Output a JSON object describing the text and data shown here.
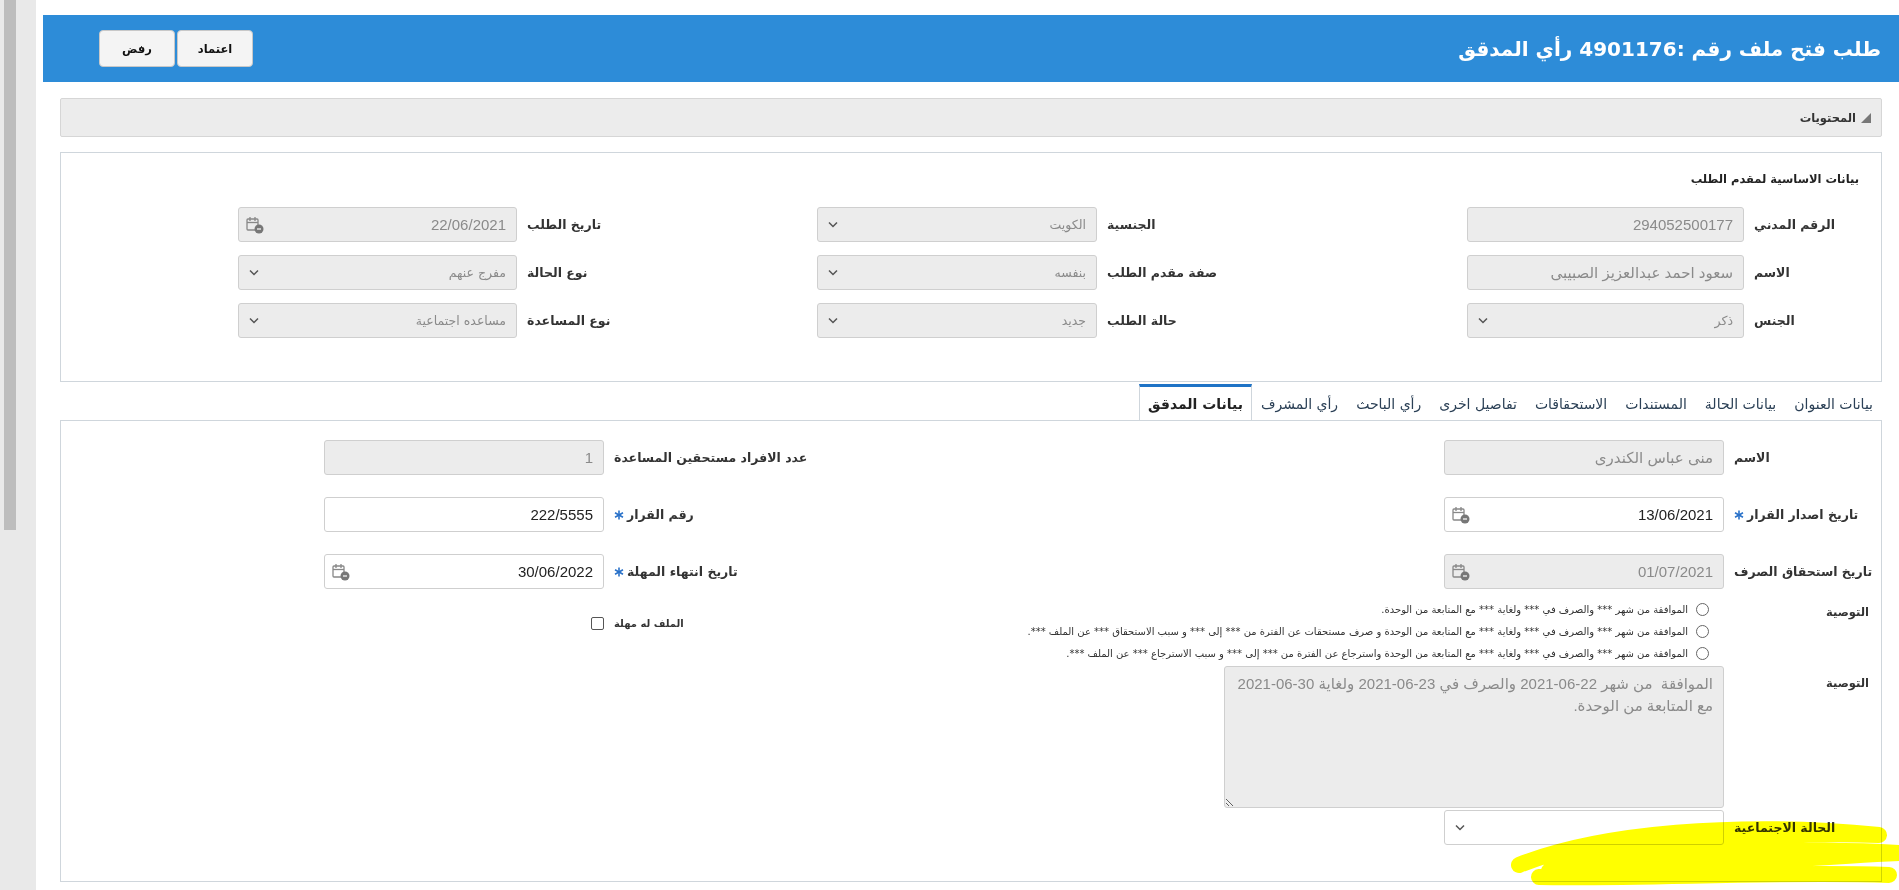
{
  "header": {
    "title": "طلب فتح ملف رقم :4901176 رأي المدقق",
    "buttons": [
      "اعتماد",
      "رفض"
    ]
  },
  "contents_bar": {
    "label": "المحتويات"
  },
  "basic_data": {
    "title": "بيانات الاساسية لمقدم الطلب",
    "columns": [
      [
        {
          "label": "الرقم المدني",
          "value": "294052500177",
          "kind": "text",
          "disabled": true
        },
        {
          "label": "الاسم",
          "value": "سعود احمد عبدالعزيز الصبيبى",
          "kind": "text",
          "disabled": true
        },
        {
          "label": "الجنس",
          "value": "ذكر",
          "kind": "select",
          "disabled": true
        }
      ],
      [
        {
          "label": "الجنسية",
          "value": "الكويت",
          "kind": "select",
          "disabled": true
        },
        {
          "label": "صفة مقدم الطلب",
          "value": "بنفسه",
          "kind": "select",
          "disabled": true
        },
        {
          "label": "حالة الطلب",
          "value": "جديد",
          "kind": "select",
          "disabled": true
        }
      ],
      [
        {
          "label": "تاريخ الطلب",
          "value": "22/06/2021",
          "kind": "date",
          "disabled": true
        },
        {
          "label": "نوع الحالة",
          "value": "مفرج عنهم",
          "kind": "select",
          "disabled": true
        },
        {
          "label": "نوع المساعدة",
          "value": "مساعده اجتماعية",
          "kind": "select",
          "disabled": true
        }
      ]
    ]
  },
  "tabs": [
    {
      "label": "بيانات العنوان",
      "selected": false
    },
    {
      "label": "بيانات الحالة",
      "selected": false
    },
    {
      "label": "المستندات",
      "selected": false
    },
    {
      "label": "الاستحقاقات",
      "selected": false
    },
    {
      "label": "تفاصيل اخرى",
      "selected": false
    },
    {
      "label": "رأي الباحث",
      "selected": false
    },
    {
      "label": "رأي المشرف",
      "selected": false
    },
    {
      "label": "بيانات المدقق",
      "selected": true
    }
  ],
  "auditor": {
    "right_fields": [
      {
        "label": "الاسم",
        "value": "منى عباس الكندرى",
        "kind": "text",
        "disabled": true,
        "required": false
      },
      {
        "label": "تاريخ اصدار القرار",
        "value": "13/06/2021",
        "kind": "date",
        "disabled": false,
        "required": true
      },
      {
        "label": "تاريخ استحقاق الصرف",
        "value": "01/07/2021",
        "kind": "date",
        "disabled": true,
        "required": false
      }
    ],
    "left_fields": [
      {
        "label": "عدد الافراد مستحقين المساعدة",
        "value": "1",
        "kind": "text",
        "disabled": true,
        "required": false
      },
      {
        "label": "رقم القرار",
        "value": "222/5555",
        "kind": "text",
        "disabled": false,
        "required": true
      },
      {
        "label": "تاريخ انتهاء المهلة",
        "value": "30/06/2022",
        "kind": "date",
        "disabled": false,
        "required": true
      }
    ],
    "recommendation_options": {
      "label": "التوصية",
      "options": [
        {
          "text": "الموافقة من شهر *** والصرف في *** ولغاية *** مع المتابعة من الوحدة.",
          "selected": false
        },
        {
          "text": "الموافقة من شهر *** والصرف في *** ولغاية *** مع المتابعة من الوحدة و صرف مستحقات عن الفترة من *** إلى *** و سبب الاستحقاق *** عن الملف ***.",
          "selected": false
        },
        {
          "text": "الموافقة من شهر *** والصرف في *** ولغاية *** مع المتابعة من الوحدة واسترجاع عن الفترة من *** إلى *** و سبب الاسترجاع *** عن الملف ***.",
          "selected": false
        }
      ]
    },
    "has_grace_period": {
      "label": "الملف له مهلة",
      "checked": false
    },
    "recommendation_text": {
      "label": "التوصية",
      "value": "الموافقة  من شهر 22-06-2021 والصرف في 23-06-2021 ولغاية 30-06-2021  مع المتابعة من الوحدة.",
      "disabled": true
    },
    "social_status": {
      "label": "الحالة الاجتماعية",
      "kind": "select",
      "disabled": false
    }
  }
}
